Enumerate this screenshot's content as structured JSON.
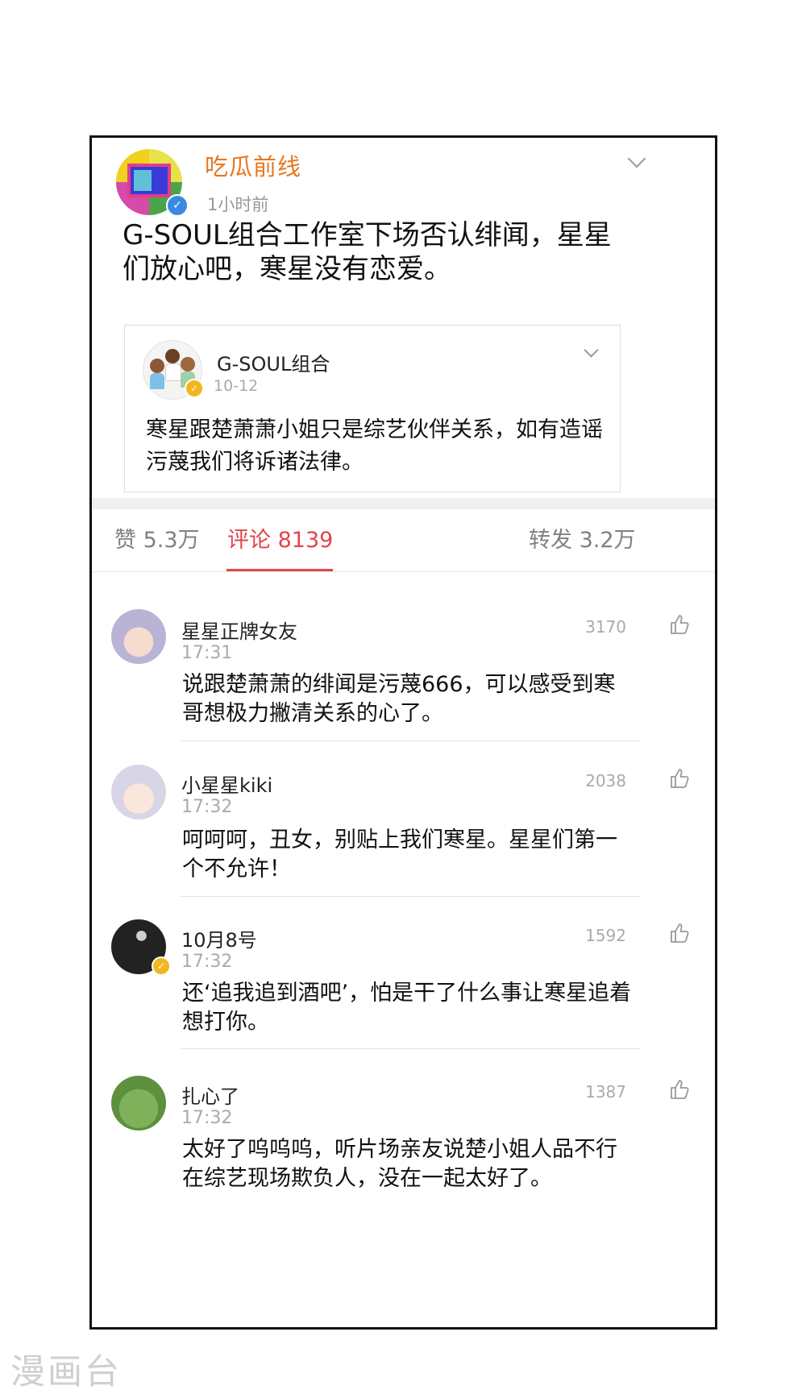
{
  "post": {
    "author": "吃瓜前线",
    "time": "1小时前",
    "text": "G-SOUL组合工作室下场否认绯闻，星星们放心吧，寒星没有恋爱。"
  },
  "repost": {
    "author": "G-SOUL组合",
    "date": "10-12",
    "text": "寒星跟楚萧萧小姐只是综艺伙伴关系，如有造谣污蔑我们将诉诸法律。"
  },
  "tabs": {
    "likes": "赞 5.3万",
    "comments": "评论 8139",
    "reposts": "转发 3.2万"
  },
  "comments": [
    {
      "name": "星星正牌女友",
      "time": "17:31",
      "likes": "3170",
      "text": "说跟楚萧萧的绯闻是污蔑666，可以感受到寒哥想极力撇清关系的心了。"
    },
    {
      "name": "小星星kiki",
      "time": "17:32",
      "likes": "2038",
      "text": "呵呵呵，丑女，别贴上我们寒星。星星们第一个不允许！"
    },
    {
      "name": "10月8号",
      "time": "17:32",
      "likes": "1592",
      "text": "还‘追我追到酒吧’，怕是干了什么事让寒星追着想打你。"
    },
    {
      "name": "扎心了",
      "time": "17:32",
      "likes": "1387",
      "text": "太好了呜呜呜，听片场亲友说楚小姐人品不行在综艺现场欺负人，没在一起太好了。"
    }
  ],
  "watermark": "漫画台",
  "icons": {
    "verified": "verified-badge-icon",
    "dropdown": "chevron-down-icon",
    "like": "thumbs-up-icon"
  },
  "colors": {
    "author_orange": "#e8771f",
    "active_tab_red": "#e0454b",
    "verified_blue": "#3a8ae0",
    "verified_gold": "#f2b71f"
  }
}
